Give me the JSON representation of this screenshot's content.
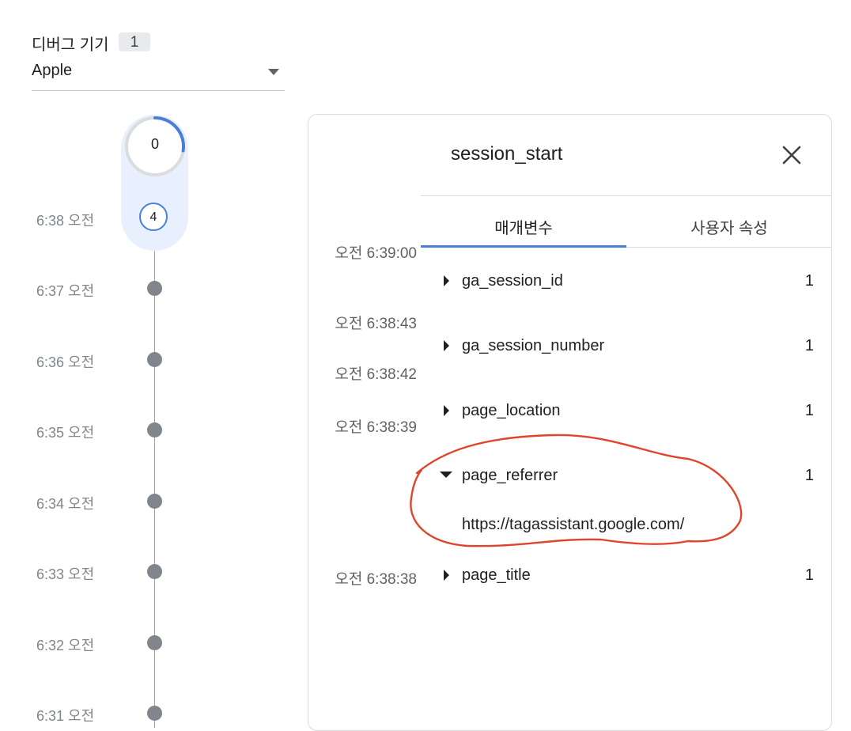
{
  "device": {
    "label": "디버그 기기",
    "count": "1",
    "selected": "Apple"
  },
  "timeline": {
    "counter": "0",
    "event_count": "4",
    "minutes": [
      "6:38 오전",
      "6:37 오전",
      "6:36 오전",
      "6:35 오전",
      "6:34 오전",
      "6:33 오전",
      "6:32 오전",
      "6:31 오전"
    ]
  },
  "timestamps": [
    "오전 6:39:00",
    "오전 6:38:43",
    "오전 6:38:42",
    "오전 6:38:39",
    "오전 6:38:38"
  ],
  "event_detail": {
    "title": "session_start",
    "tabs": [
      "매개변수",
      "사용자 속성"
    ],
    "active_tab": "매개변수",
    "params": [
      {
        "name": "ga_session_id",
        "count": "1",
        "expanded": false
      },
      {
        "name": "ga_session_number",
        "count": "1",
        "expanded": false
      },
      {
        "name": "page_location",
        "count": "1",
        "expanded": false
      },
      {
        "name": "page_referrer",
        "count": "1",
        "expanded": true,
        "value": "https://tagassistant.google.com/"
      },
      {
        "name": "page_title",
        "count": "1",
        "expanded": false
      }
    ]
  },
  "colors": {
    "accent": "#4a7fd9",
    "timeline_highlight": "#e8f0fe",
    "dot": "#80868b",
    "annotation": "#e0452b"
  }
}
